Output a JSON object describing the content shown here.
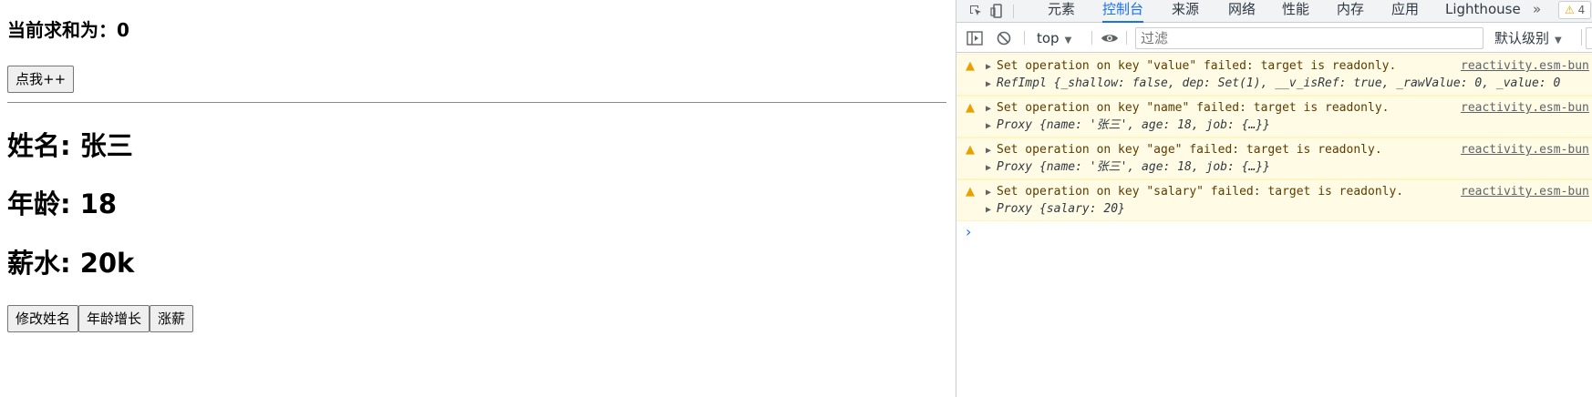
{
  "app": {
    "sum_text": "当前求和为：0",
    "inc_button": "点我++",
    "name_text": "姓名: 张三",
    "age_text": "年龄: 18",
    "salary_text": "薪水: 20k",
    "buttons": [
      "修改姓名",
      "年龄增长",
      "涨薪"
    ]
  },
  "devtools": {
    "tabs": [
      "元素",
      "控制台",
      "来源",
      "网络",
      "性能",
      "内存",
      "应用",
      "Lighthouse"
    ],
    "active_tab": "控制台",
    "more_tabs": "»",
    "warning_count": "4",
    "context": "top",
    "filter_placeholder": "过滤",
    "level": "默认级别",
    "messages": [
      {
        "text": "Set operation on key \"value\" failed: target is readonly.",
        "source": "reactivity.esm-bun",
        "object": "RefImpl {_shallow: false, dep: Set(1), __v_isRef: true, _rawValue: 0, _value: 0"
      },
      {
        "text": "Set operation on key \"name\" failed: target is readonly.",
        "source": "reactivity.esm-bun",
        "object": "Proxy {name: '张三', age: 18, job: {…}}"
      },
      {
        "text": "Set operation on key \"age\" failed: target is readonly.",
        "source": "reactivity.esm-bun",
        "object": "Proxy {name: '张三', age: 18, job: {…}}"
      },
      {
        "text": "Set operation on key \"salary\" failed: target is readonly.",
        "source": "reactivity.esm-bun",
        "object": "Proxy {salary: 20}"
      }
    ],
    "prompt": "›"
  },
  "colors": {
    "active_tab": "#1a73e8",
    "warning_bg": "#fffbe5",
    "warning_icon": "#e8a200"
  }
}
